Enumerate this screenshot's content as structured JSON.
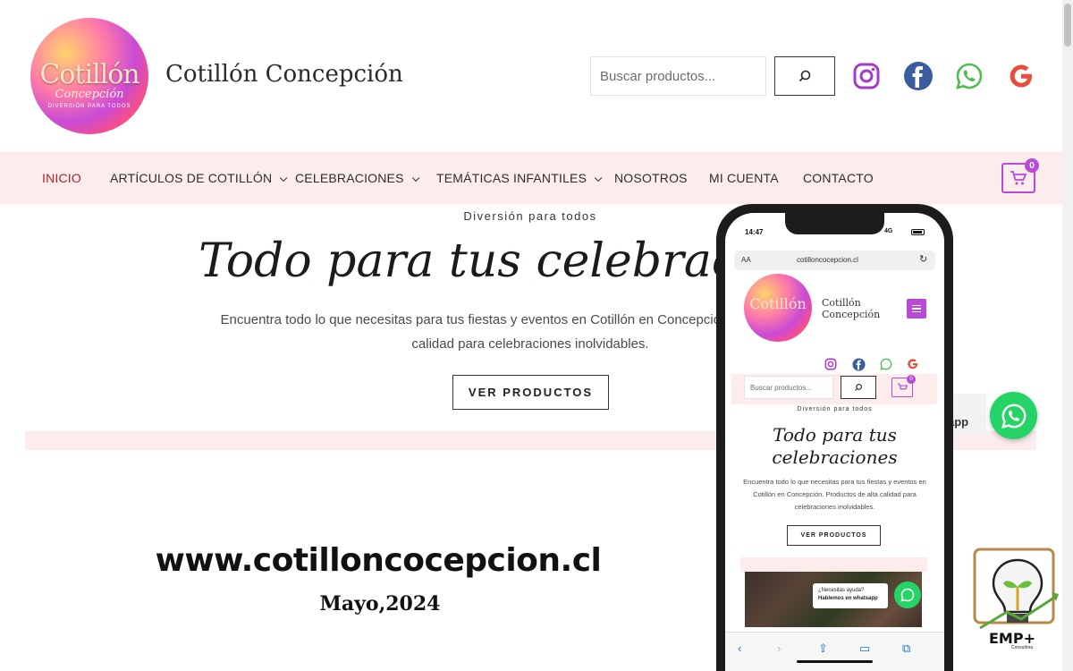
{
  "site": {
    "title": "Cotillón Concepción",
    "logo_text": "Cotillón",
    "logo_subtext": "Concepción",
    "logo_tagline": "DIVERSIÓN PARA TODOS"
  },
  "search": {
    "placeholder": "Buscar productos..."
  },
  "social": [
    "instagram-icon",
    "facebook-icon",
    "whatsapp-icon",
    "google-icon"
  ],
  "nav": {
    "items": [
      {
        "label": "INICIO",
        "active": true
      },
      {
        "label": "ARTÍCULOS DE COTILLÓN",
        "dropdown": true
      },
      {
        "label": "CELEBRACIONES",
        "dropdown": true
      },
      {
        "label": "TEMÁTICAS INFANTILES",
        "dropdown": true
      },
      {
        "label": "NOSOTROS"
      },
      {
        "label": "MI CUENTA"
      },
      {
        "label": "CONTACTO"
      }
    ],
    "cart_count": "0"
  },
  "hero": {
    "eyebrow": "Diversión para todos",
    "title": "Todo para tus celebraciones",
    "description_line1": "Encuentra todo lo que necesitas para tus fiestas y eventos en Cotillón en Concepción. Productos de alta",
    "description_line2": "calidad para celebraciones inolvidables.",
    "button": "VER PRODUCTOS"
  },
  "whatsapp_tab": "app",
  "promo": {
    "url": "www.cotilloncocepcion.cl",
    "date": "Mayo,2024"
  },
  "mobile": {
    "time": "14:47",
    "signal": "4G",
    "aa": "AA",
    "url": "cotilloncocepcion.cl",
    "site_title_line1": "Cotillón",
    "site_title_line2": "Concepción",
    "search_placeholder": "Buscar productos...",
    "cart_count": "0",
    "eyebrow": "Diversión para todos",
    "title": "Todo para tus celebraciones",
    "description": "Encuentra todo lo que necesitas para tus fiestas y eventos en Cotillón en Concepción. Productos de alta calidad para celebraciones inolvidables.",
    "button": "VER PRODUCTOS",
    "help_line1": "¿Necesitas ayuda?",
    "help_line2": "Hablemos en whatsapp"
  },
  "consultant": {
    "name": "EMP+",
    "sub": "Consultora"
  },
  "colors": {
    "accent": "#b74bd6",
    "nav_bg": "#fcecec",
    "active_nav": "#b01e2f",
    "whatsapp": "#25d366"
  }
}
